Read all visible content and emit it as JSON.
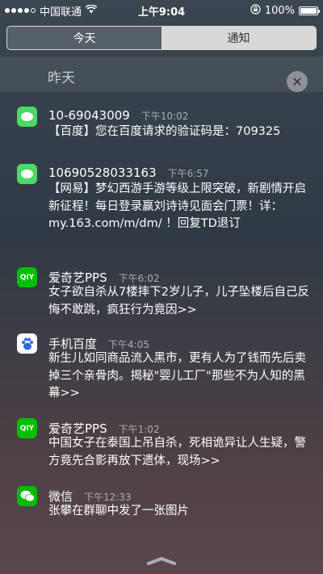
{
  "status": {
    "carrier": "中国联通",
    "time": "上午9:04",
    "battery": "100%"
  },
  "tabs": {
    "today": "今天",
    "notifications": "通知"
  },
  "section": {
    "title": "昨天",
    "clear_icon": "close-icon"
  },
  "notifications": [
    {
      "app": "10-69043009",
      "time": "下午10:02",
      "body": "【百度】您在百度请求的验证码是：709325",
      "icon": "messages-icon"
    },
    {
      "app": "10690528033163",
      "time": "下午6:57",
      "body": "【网易】梦幻西游手游等级上限突破，新剧情开启新征程！每日登录赢刘诗诗见面会门票！详： my.163.com/m/dm/ ！回复TD退订",
      "icon": "messages-icon"
    },
    {
      "app": "爱奇艺PPS",
      "time": "下午6:02",
      "body": "女子欲自杀从7楼摔下2岁儿子，儿子坠楼后自己反悔不敢跳，疯狂行为竟因>>",
      "icon": "iqiyi-icon"
    },
    {
      "app": "手机百度",
      "time": "下午4:05",
      "body": "新生儿如同商品流入黑市，更有人为了钱而先后卖掉三个亲骨肉。揭秘\"婴儿工厂\"那些不为人知的黑幕>>",
      "icon": "baidu-icon"
    },
    {
      "app": "爱奇艺PPS",
      "time": "下午1:02",
      "body": "中国女子在泰国上吊自杀，死相诡异让人生疑，警方竟先合影再放下遗体，现场>>",
      "icon": "iqiyi-icon"
    },
    {
      "app": "微信",
      "time": "下午12:33",
      "body": "张攀在群聊中发了一张图片",
      "icon": "wechat-icon"
    }
  ]
}
